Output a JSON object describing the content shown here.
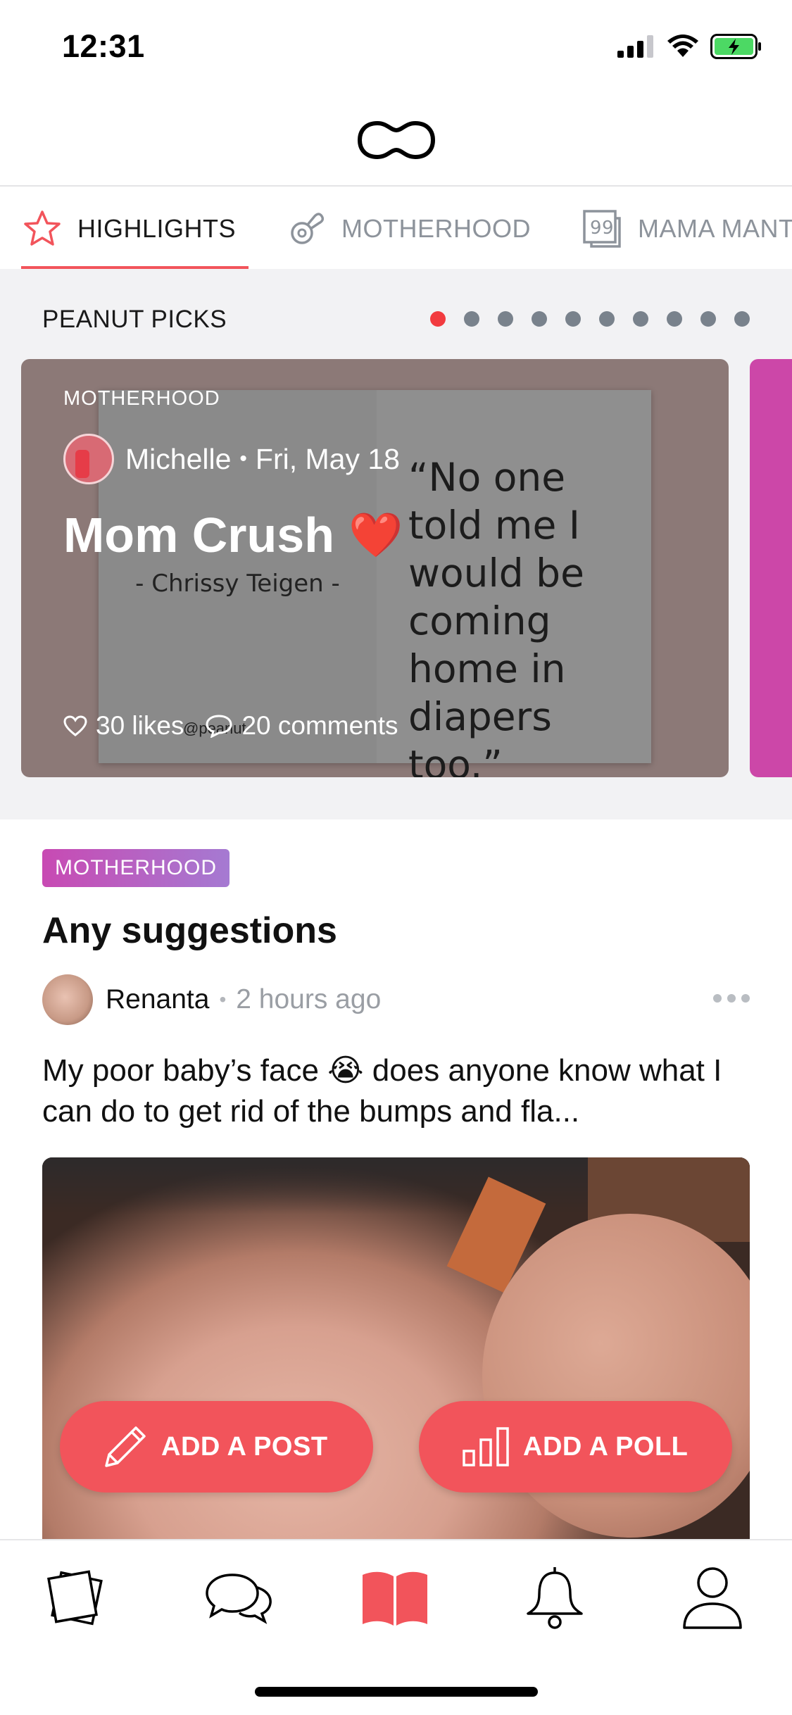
{
  "status_bar": {
    "time": "12:31"
  },
  "tabs": [
    {
      "label": "HIGHLIGHTS",
      "icon": "star-icon",
      "active": true
    },
    {
      "label": "MOTHERHOOD",
      "icon": "pacifier-icon",
      "active": false
    },
    {
      "label": "MAMA MANTRAS",
      "icon": "quote-icon",
      "active": false
    }
  ],
  "picks": {
    "title": "PEANUT PICKS",
    "dot_count": 10,
    "active_dot": 0,
    "card": {
      "category": "MOTHERHOOD",
      "author": "Michelle",
      "date": "Fri, May 18",
      "title": "Mom Crush",
      "title_emoji": "❤️",
      "likes": "30 likes",
      "comments": "20 comments",
      "image_quote": "“No one told me I would be coming home in diapers too.”",
      "image_byline": "- Chrissy Teigen -",
      "image_watermark": "@peanut"
    }
  },
  "post": {
    "tag": "MOTHERHOOD",
    "title": "Any suggestions",
    "author": "Renanta",
    "time": "2 hours ago",
    "body": "My poor baby’s face 😭 does anyone know what I can do to get rid of the bumps and fla..."
  },
  "fabs": {
    "add_post": "ADD A POST",
    "add_poll": "ADD A POLL"
  },
  "nav": [
    {
      "name": "nav-cards",
      "icon": "cards-icon",
      "active": false
    },
    {
      "name": "nav-chat",
      "icon": "chat-icon",
      "active": false
    },
    {
      "name": "nav-pages",
      "icon": "book-icon",
      "active": true
    },
    {
      "name": "nav-notifications",
      "icon": "bell-icon",
      "active": false
    },
    {
      "name": "nav-profile",
      "icon": "person-icon",
      "active": false
    }
  ],
  "colors": {
    "accent": "#f2545b",
    "tag_gradient_start": "#c84ab3",
    "tag_gradient_end": "#a57ad2",
    "tab_inactive": "#8d939b",
    "battery": "#4cd964"
  }
}
